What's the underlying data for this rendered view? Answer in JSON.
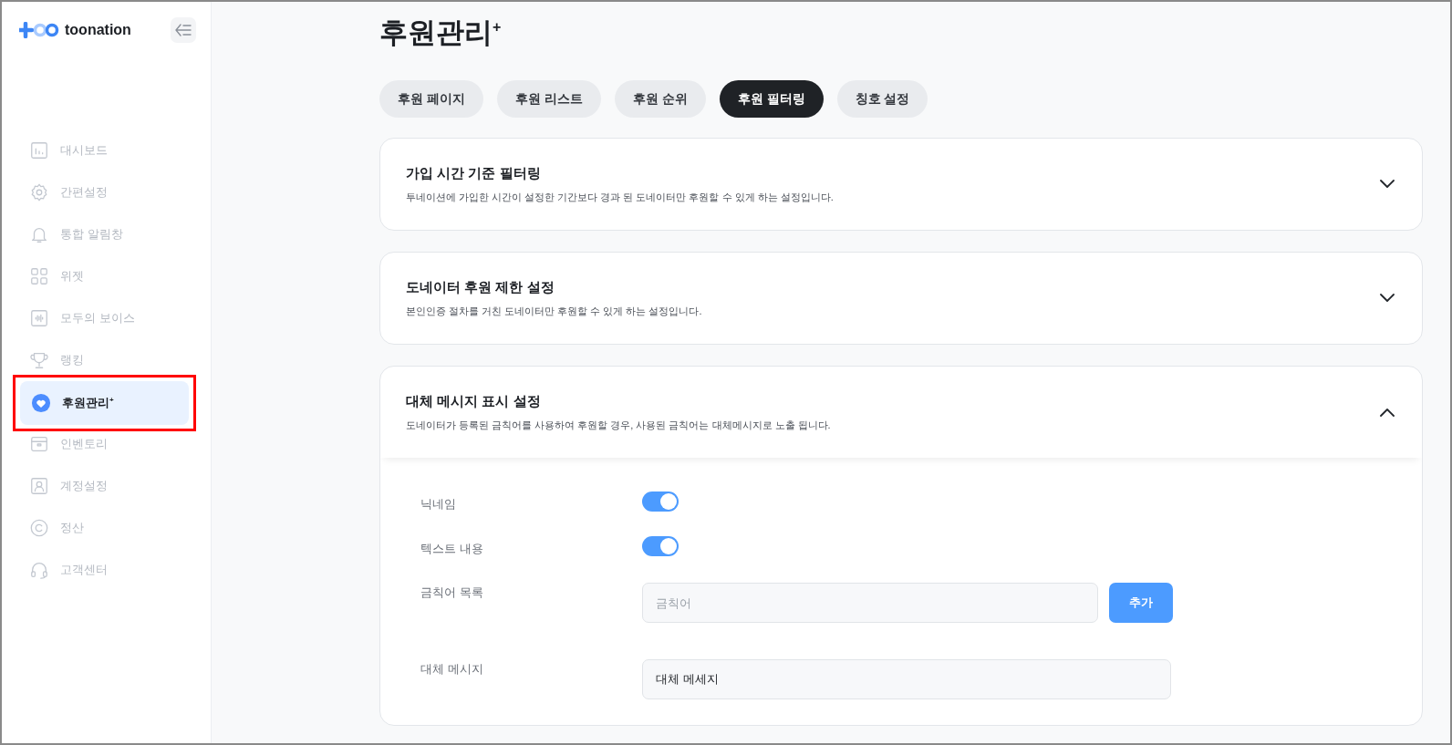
{
  "sidebar": {
    "logo": "toonation",
    "items": [
      {
        "label": "대시보드",
        "selected": false,
        "highlighted": false
      },
      {
        "label": "간편설정",
        "selected": false,
        "highlighted": false
      },
      {
        "label": "통합 알림창",
        "selected": false,
        "highlighted": false
      },
      {
        "label": "위젯",
        "selected": false,
        "highlighted": false
      },
      {
        "label": "모두의 보이스",
        "selected": false,
        "highlighted": false
      },
      {
        "label": "랭킹",
        "selected": false,
        "highlighted": false
      },
      {
        "label": "후원관리$^{+}$",
        "selected": true,
        "highlighted": true
      },
      {
        "label": "인벤토리",
        "selected": false,
        "highlighted": false
      },
      {
        "label": "계정설정",
        "selected": false,
        "highlighted": false
      },
      {
        "label": "정산",
        "selected": false,
        "highlighted": false
      },
      {
        "label": "고객센터",
        "selected": false,
        "highlighted": false
      }
    ]
  },
  "page_title": "후원관리$^{+}$",
  "tabs": [
    {
      "label": "후원 페이지",
      "selected": false
    },
    {
      "label": "후원 리스트",
      "selected": false
    },
    {
      "label": "후원 순위",
      "selected": false
    },
    {
      "label": "후원 필터링",
      "selected": true
    },
    {
      "label": "칭호 설정",
      "selected": false
    }
  ],
  "cards": [
    {
      "title": "가입 시간 기준 필터링",
      "description": "투네이션에 가입한 시간이 설정한 기간보다 경과 된 도네이터만 후원할 수 있게 하는 설정입니다.",
      "expanded": false
    },
    {
      "title": "도네이터 후원 제한 설정",
      "description": "본인인증 절차를 거친 도네이터만 후원할 수 있게 하는 설정입니다.",
      "expanded": false
    },
    {
      "title": "대체 메시지 표시 설정",
      "description": "도네이터가 등록된 금칙어를 사용하여 후원할 경우, 사용된 금칙어는 대체메시지로 노출 됩니다.",
      "expanded": true,
      "settings": [
        {
          "kind": "toggle",
          "label": "닉네임",
          "on": true
        },
        {
          "kind": "toggle",
          "label": "텍스트 내용",
          "on": true
        },
        {
          "kind": "input_button",
          "label": "금칙어 목록",
          "placeholder": "금칙어",
          "button": "추가"
        },
        {
          "kind": "input",
          "label": "대체 메시지",
          "value": "대체 메세지"
        }
      ]
    }
  ]
}
